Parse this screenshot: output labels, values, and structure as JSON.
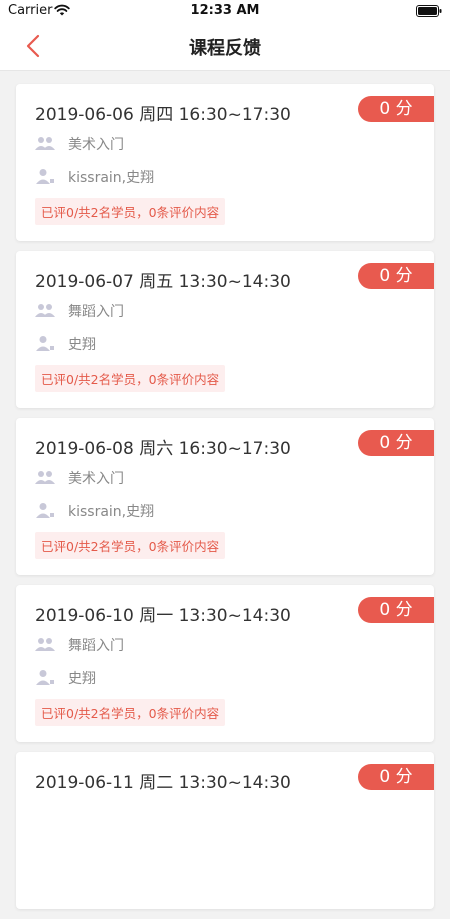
{
  "status_bar": {
    "carrier": "Carrier",
    "time": "12:33 AM"
  },
  "nav": {
    "title": "课程反馈"
  },
  "colors": {
    "accent": "#e85a4f",
    "tag_bg": "#fdeeee",
    "tag_text": "#e45a4a"
  },
  "cards": [
    {
      "datetime": "2019-06-06 周四 16:30~17:30",
      "score": "0 分",
      "course": "美术入门",
      "teachers": "kissrain,史翔",
      "review": "已评0/共2名学员，0条评价内容"
    },
    {
      "datetime": "2019-06-07 周五 13:30~14:30",
      "score": "0 分",
      "course": "舞蹈入门",
      "teachers": "史翔",
      "review": "已评0/共2名学员，0条评价内容"
    },
    {
      "datetime": "2019-06-08 周六 16:30~17:30",
      "score": "0 分",
      "course": "美术入门",
      "teachers": "kissrain,史翔",
      "review": "已评0/共2名学员，0条评价内容"
    },
    {
      "datetime": "2019-06-10 周一 13:30~14:30",
      "score": "0 分",
      "course": "舞蹈入门",
      "teachers": "史翔",
      "review": "已评0/共2名学员，0条评价内容"
    },
    {
      "datetime": "2019-06-11 周二 13:30~14:30",
      "score": "0 分",
      "course": "",
      "teachers": "",
      "review": ""
    }
  ]
}
